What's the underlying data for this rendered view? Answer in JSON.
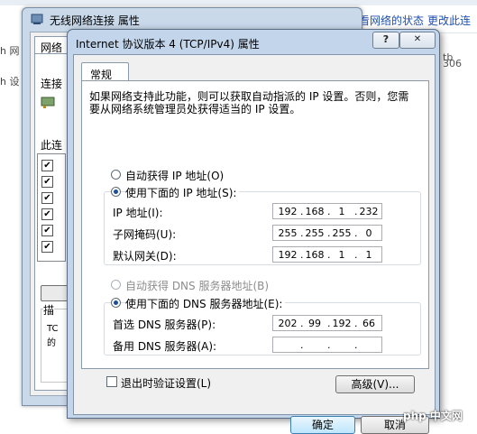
{
  "background": {
    "links": [
      "看网络的状态",
      "更改此连接"
    ],
    "left_texts": [
      "h 网",
      "h 设"
    ],
    "right_texts": [
      "tb",
      "306"
    ]
  },
  "adapter_dialog": {
    "title": "无线网络连接 属性",
    "tab": "网络",
    "labels": [
      "连接",
      "此连",
      "描"
    ],
    "group_text": [
      "TC",
      "的"
    ]
  },
  "dialog": {
    "title": "Internet 协议版本 4 (TCP/IPv4) 属性",
    "help_label": "?",
    "close_label": "✕",
    "tab": "常规",
    "description": "如果网络支持此功能，则可以获取自动指派的 IP 设置。否则，您需要从网络系统管理员处获得适当的 IP 设置。",
    "ip_auto_label": "自动获得 IP 地址(O)",
    "ip_manual_label": "使用下面的 IP 地址(S):",
    "ip_address_label": "IP 地址(I):",
    "ip_address": [
      "192",
      "168",
      "1",
      "232"
    ],
    "subnet_label": "子网掩码(U):",
    "subnet": [
      "255",
      "255",
      "255",
      "0"
    ],
    "gateway_label": "默认网关(D):",
    "gateway": [
      "192",
      "168",
      "1",
      "1"
    ],
    "dns_auto_label": "自动获得 DNS 服务器地址(B)",
    "dns_manual_label": "使用下面的 DNS 服务器地址(E):",
    "dns_pref_label": "首选 DNS 服务器(P):",
    "dns_pref": [
      "202",
      "99",
      "192",
      "66"
    ],
    "dns_alt_label": "备用 DNS 服务器(A):",
    "dns_alt": [
      "",
      "",
      "",
      ""
    ],
    "validate_label": "退出时验证设置(L)",
    "advanced_label": "高级(V)...",
    "ok_label": "确定",
    "cancel_label": "取消"
  },
  "watermark": "php 中文网"
}
